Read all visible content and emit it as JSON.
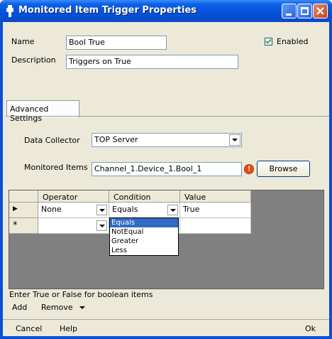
{
  "window": {
    "title": "Monitored Item Trigger Properties",
    "accent": "#0a4fd6"
  },
  "general": {
    "name_label": "Name",
    "name_value": "Bool True",
    "description_label": "Description",
    "description_value": "Triggers on True",
    "enabled_label": "Enabled",
    "enabled_checked": true
  },
  "tabs": [
    {
      "label": "Advanced Settings",
      "active": true
    }
  ],
  "advanced": {
    "data_collector_label": "Data Collector",
    "data_collector_value": "TOP Server",
    "monitored_items_label": "Monitored Items",
    "monitored_items_value": "Channel_1.Device_1.Bool_1",
    "browse_label": "Browse",
    "warning_glyph": "!"
  },
  "grid": {
    "columns": [
      "Operator",
      "Condition",
      "Value"
    ],
    "rows": [
      {
        "marker": "▶",
        "operator": "None",
        "condition": "Equals",
        "value": "True"
      },
      {
        "marker": "*",
        "operator": "",
        "condition": "",
        "value": ""
      }
    ],
    "condition_options": [
      "Equals",
      "NotEqual",
      "Greater",
      "Less"
    ],
    "condition_selected": "Equals"
  },
  "hint": "Enter True or False for boolean items",
  "toolbar": {
    "add_label": "Add",
    "remove_label": "Remove"
  },
  "statusbar": {
    "cancel_label": "Cancel",
    "help_label": "Help",
    "ok_label": "Ok"
  }
}
